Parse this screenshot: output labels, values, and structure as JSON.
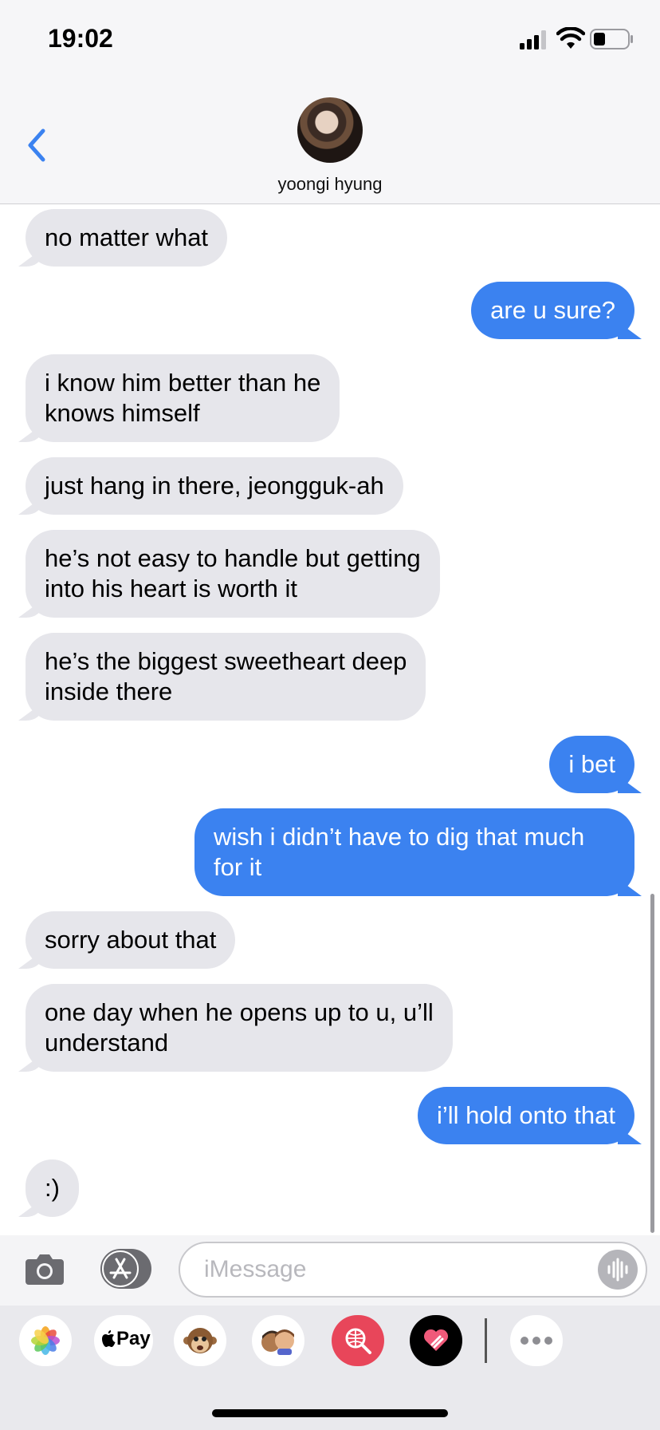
{
  "status": {
    "time": "19:02"
  },
  "header": {
    "contact_name": "yoongi hyung"
  },
  "messages": [
    {
      "from": "them",
      "text": "no matter what"
    },
    {
      "from": "me",
      "text": "are u sure?"
    },
    {
      "from": "them",
      "text": "i know him better than he\nknows himself"
    },
    {
      "from": "them",
      "text": "just hang in there, jeongguk-ah"
    },
    {
      "from": "them",
      "text": "he’s not easy to handle but getting\ninto his heart is worth it"
    },
    {
      "from": "them",
      "text": "he’s the biggest sweetheart deep\ninside there"
    },
    {
      "from": "me",
      "text": "i bet"
    },
    {
      "from": "me",
      "text": "wish i didn’t have to dig that much\nfor it"
    },
    {
      "from": "them",
      "text": "sorry about that"
    },
    {
      "from": "them",
      "text": "one day when he opens up to u, u’ll\nunderstand"
    },
    {
      "from": "me",
      "text": "i’ll hold onto that"
    },
    {
      "from": "them",
      "text": ":)"
    }
  ],
  "input": {
    "placeholder": "iMessage"
  },
  "app_drawer": {
    "apple_pay_label": "Pay",
    "apps": [
      "photos-icon",
      "apple-pay-icon",
      "animoji-icon",
      "memoji-icon",
      "search-images-icon",
      "digital-touch-icon",
      "more-icon"
    ]
  },
  "colors": {
    "sent_bubble": "#3b82f0",
    "received_bubble": "#e6e6eb",
    "accent": "#3b82f0"
  }
}
